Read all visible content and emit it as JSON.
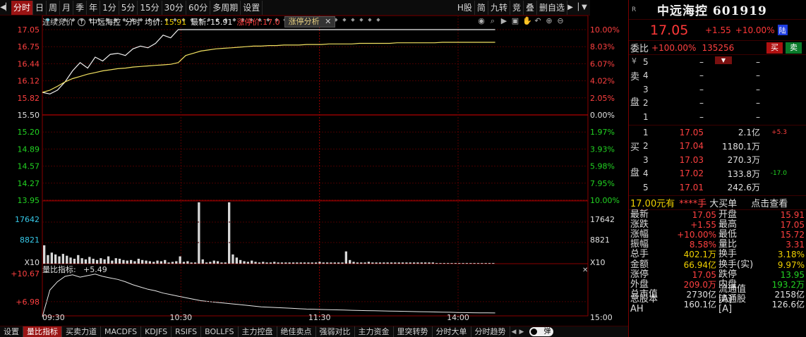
{
  "toolbar": {
    "left": [
      "分时",
      "日",
      "周",
      "月",
      "季",
      "年",
      "1分",
      "5分",
      "15分",
      "30分",
      "60分",
      "多周期",
      "设置"
    ],
    "right": [
      "H股",
      "简",
      "九转",
      "竞",
      "叠",
      "删自选"
    ]
  },
  "header": {
    "mode": "连续竞价",
    "name": "中远海控",
    "view": "分时",
    "avg_label": "均价:",
    "avg": "15.91",
    "last_label": "最新:",
    "last": "15.91",
    "limit_label": "涨停价:17.0",
    "tag": "涨停分析"
  },
  "axis": {
    "price_left": [
      "17.05",
      "16.75",
      "16.44",
      "16.12",
      "15.82",
      "15.50",
      "15.20",
      "14.89",
      "14.57",
      "14.27",
      "13.95"
    ],
    "pct_right": [
      "10.00%",
      "8.03%",
      "6.07%",
      "4.02%",
      "2.05%",
      "0.00%",
      "1.97%",
      "3.93%",
      "5.98%",
      "7.95%",
      "10.00%"
    ],
    "vol_left": [
      "17642",
      "8821"
    ],
    "vol_right": [
      "17642",
      "8821"
    ],
    "vol_unit": "X10",
    "ind_left": [
      "+10.67",
      "+6.98"
    ],
    "time": [
      "09:30",
      "10:30",
      "11:30",
      "14:00",
      "15:00"
    ],
    "indicator_title": "量比指标:",
    "indicator_value": "+5.49"
  },
  "chart_data": {
    "type": "line",
    "title": "",
    "prev_close": 15.5,
    "ylim": [
      13.95,
      17.05
    ],
    "xlabels": [
      "09:30",
      "10:30",
      "11:30",
      "14:00",
      "15:00"
    ],
    "series": [
      {
        "values": [
          15.91,
          15.88,
          15.95,
          16.1,
          16.3,
          16.45,
          16.35,
          16.55,
          16.48,
          16.6,
          16.62,
          16.58,
          16.7,
          16.75,
          16.72,
          16.8,
          16.95,
          16.9,
          17.05,
          17.05,
          17.05,
          17.05,
          17.05,
          17.05,
          17.05,
          17.05,
          17.05,
          17.05,
          17.05,
          17.05,
          17.05,
          17.05,
          17.05,
          17.05,
          17.05,
          17.05,
          17.05,
          17.05,
          17.05,
          17.05,
          17.05,
          17.05,
          17.05,
          17.05,
          17.05,
          17.05,
          17.05,
          17.05,
          17.05,
          17.05,
          17.05,
          17.05,
          17.05,
          17.05,
          17.05,
          17.05,
          17.05,
          17.05,
          17.05,
          17.05,
          17.05
        ]
      },
      {
        "values": [
          15.91,
          15.95,
          16.02,
          16.1,
          16.16,
          16.2,
          16.24,
          16.27,
          16.3,
          16.32,
          16.34,
          16.35,
          16.37,
          16.38,
          16.39,
          16.4,
          16.41,
          16.42,
          16.45,
          16.58,
          16.62,
          16.66,
          16.68,
          16.7,
          16.71,
          16.72,
          16.73,
          16.74,
          16.75,
          16.75,
          16.76,
          16.76,
          16.77,
          16.77,
          16.77,
          16.78,
          16.78,
          16.78,
          16.79,
          16.79,
          16.79,
          16.79,
          16.8,
          16.8,
          16.8,
          16.8,
          16.8,
          16.81,
          16.81,
          16.81,
          16.81,
          16.81,
          16.81,
          16.82,
          16.82,
          16.82,
          16.82,
          16.82,
          16.82,
          16.82,
          16.82
        ]
      }
    ],
    "volume": [
      30,
      14,
      18,
      15,
      12,
      16,
      13,
      10,
      8,
      14,
      9,
      7,
      11,
      8,
      6,
      9,
      7,
      12,
      5,
      9,
      8,
      6,
      5,
      6,
      4,
      8,
      6,
      5,
      4,
      3,
      5,
      4,
      6,
      2,
      3,
      4,
      12,
      3,
      4,
      2,
      2,
      100,
      7,
      2,
      3,
      5,
      4,
      2,
      2,
      100,
      15,
      10,
      6,
      4,
      3,
      5,
      3,
      2,
      3,
      2,
      2,
      3,
      2,
      2,
      2,
      2,
      2,
      2,
      2,
      2,
      2,
      2,
      2,
      3,
      2,
      2,
      2,
      2,
      2,
      2,
      20,
      6,
      3,
      2,
      2,
      2,
      3,
      2,
      2,
      2,
      2,
      2,
      2,
      2,
      2,
      2,
      2,
      2,
      2,
      2,
      2,
      2,
      2,
      2,
      1,
      1,
      1,
      1,
      1,
      1,
      1,
      1,
      1,
      1,
      1,
      1,
      1,
      1,
      1,
      1
    ],
    "indicator": [
      5.0,
      8.5,
      9.6,
      10.3,
      10.5,
      10.2,
      10.4,
      10.6,
      10.3,
      10.1,
      9.9,
      9.6,
      9.2,
      8.9,
      8.6,
      8.4,
      8.1,
      7.9,
      7.7,
      7.5,
      7.3,
      7.1,
      7.0,
      6.9,
      6.8,
      6.7,
      6.6,
      6.5,
      6.4,
      6.3,
      6.25,
      6.2,
      6.15,
      6.1,
      6.05,
      6.0,
      5.98,
      5.95,
      5.92,
      5.9,
      5.87,
      5.84,
      5.82,
      5.8,
      5.78,
      5.76,
      5.74,
      5.72,
      5.7,
      5.68,
      5.66,
      5.64,
      5.62,
      5.6,
      5.58,
      5.56,
      5.54,
      5.52,
      5.51,
      5.5,
      5.49
    ]
  },
  "tabs": [
    "设置",
    "量比指标",
    "买卖力道",
    "MACDFS",
    "KDJFS",
    "RSIFS",
    "BOLLFS",
    "主力控盘",
    "绝佳卖点",
    "强弱对比",
    "主力资金",
    "里突转势",
    "分时大单",
    "分时趋势"
  ],
  "toggle_label": "弹",
  "panel": {
    "r_mark": "R",
    "title": "中远海控 601919",
    "price": "17.05",
    "change": "+1.55",
    "percent": "+10.00%",
    "badge": "陆",
    "wb_label": "委比",
    "wb_pct": "+100.00%",
    "wb_diff": "135256",
    "buy_btn": "买",
    "sell_btn": "卖",
    "sell_label": [
      "卖",
      "盘"
    ],
    "buy_label": [
      "买",
      "盘"
    ],
    "sell": [
      {
        "lvl": "5",
        "price": "–",
        "vol": "–"
      },
      {
        "lvl": "4",
        "price": "–",
        "vol": "–"
      },
      {
        "lvl": "3",
        "price": "–",
        "vol": "–"
      },
      {
        "lvl": "2",
        "price": "–",
        "vol": "–"
      },
      {
        "lvl": "1",
        "price": "–",
        "vol": "–"
      }
    ],
    "sell_mark": "¥",
    "buy": [
      {
        "lvl": "1",
        "price": "17.05",
        "vol": "2.1亿",
        "x": "+5.3"
      },
      {
        "lvl": "2",
        "price": "17.04",
        "vol": "1180.1万",
        "x": ""
      },
      {
        "lvl": "3",
        "price": "17.03",
        "vol": "270.3万",
        "x": ""
      },
      {
        "lvl": "4",
        "price": "17.02",
        "vol": "133.8万",
        "x": "-17.0"
      },
      {
        "lvl": "5",
        "price": "17.01",
        "vol": "242.6万",
        "x": ""
      }
    ],
    "note_a": "17.00元有",
    "note_b": "****手",
    "note_c": "大买单",
    "note_d": "点击查看",
    "stats": [
      {
        "k1": "最新",
        "v1": "17.05",
        "c1": "red",
        "k2": "开盘",
        "v2": "15.91",
        "c2": "red"
      },
      {
        "k1": "涨跌",
        "v1": "+1.55",
        "c1": "red",
        "k2": "最高",
        "v2": "17.05",
        "c2": "red"
      },
      {
        "k1": "涨幅",
        "v1": "+10.00%",
        "c1": "red",
        "k2": "最低",
        "v2": "15.72",
        "c2": "red"
      },
      {
        "k1": "振幅",
        "v1": "8.58%",
        "c1": "red",
        "k2": "量比",
        "v2": "3.31",
        "c2": "red"
      },
      {
        "k1": "总手",
        "v1": "402.1万",
        "c1": "yellow",
        "k2": "换手",
        "v2": "3.18%",
        "c2": "yellow"
      },
      {
        "k1": "金额",
        "v1": "66.94亿",
        "c1": "yellow",
        "k2": "换手(实)",
        "v2": "9.97%",
        "c2": "yellow"
      },
      {
        "k1": "涨停",
        "v1": "17.05",
        "c1": "red",
        "k2": "跌停",
        "v2": "13.95",
        "c2": "green"
      },
      {
        "k1": "外盘",
        "v1": "209.0万",
        "c1": "red",
        "k2": "内盘",
        "v2": "193.2万",
        "c2": "green"
      },
      {
        "k1": "总市值",
        "v1": "2730亿",
        "c1": "white",
        "k2": "流通值[A]",
        "v2": "2158亿",
        "c2": "white"
      },
      {
        "k1": "总股本AH",
        "v1": "160.1亿",
        "c1": "white",
        "k2": "流通股[A]",
        "v2": "126.6亿",
        "c2": "white"
      }
    ]
  }
}
